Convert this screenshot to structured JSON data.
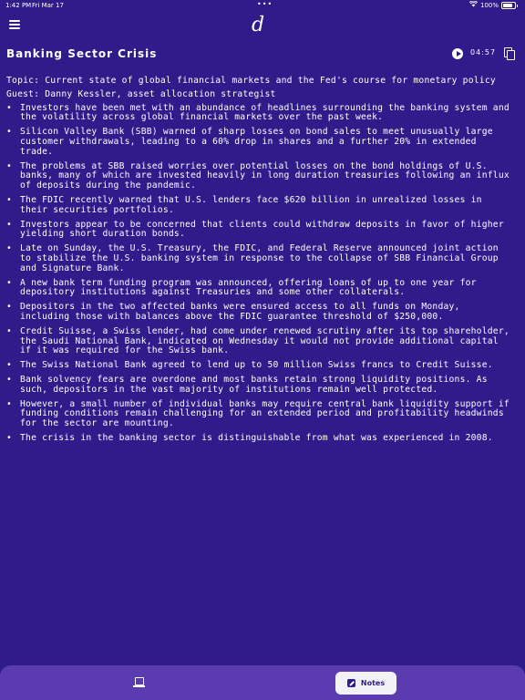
{
  "status_bar": {
    "time": "1:42 PM",
    "date": "Fri Mar 17",
    "battery": "100%"
  },
  "app": {
    "logo": "d"
  },
  "header": {
    "title": "Banking Sector Crisis",
    "duration": "04:57"
  },
  "content": {
    "topic": "Topic: Current state of global financial markets and the Fed's course for monetary policy",
    "guest": "Guest: Danny Kessler, asset allocation strategist",
    "bullets": [
      "Investors have been met with an abundance of headlines surrounding the banking system and the volatility across global financial markets over the past week.",
      "Silicon Valley Bank (SBB) warned of sharp losses on bond sales to meet unusually large customer withdrawals, leading to a 60% drop in shares and a further 20% in extended trade.",
      "The problems at SBB raised worries over potential losses on the bond holdings of U.S. banks, many of which are invested heavily in long duration treasuries following an influx of deposits during the pandemic.",
      "The FDIC recently warned that U.S. lenders face $620 billion in unrealized losses in their securities portfolios.",
      "Investors appear to be concerned that clients could withdraw deposits in favor of higher yielding short duration bonds.",
      "Late on Sunday, the U.S. Treasury, the FDIC, and Federal Reserve announced joint action to stabilize the U.S. banking system in response to the collapse of SBB Financial Group and Signature Bank.",
      "A new bank term funding program was announced, offering loans of up to one year for depository institutions against Treasuries and some other collaterals.",
      "Depositors in the two affected banks were ensured access to all funds on Monday, including those with balances above the FDIC guarantee threshold of $250,000.",
      "Credit Suisse, a Swiss lender, had come under renewed scrutiny after its top shareholder, the Saudi National Bank, indicated on Wednesday it would not provide additional capital if it was required for the Swiss bank.",
      "The Swiss National Bank agreed to lend up to 50 million Swiss francs to Credit Suisse.",
      "Bank solvency fears are overdone and most banks retain strong liquidity positions. As such, depositors in the vast majority of institutions remain well protected.",
      "However, a small number of individual banks may require central bank liquidity support if funding conditions remain challenging for an extended period and profitability headwinds for the sector are mounting.",
      "The crisis in the banking sector is distinguishable from what was experienced in 2008."
    ]
  },
  "bottom_bar": {
    "notes_label": "Notes"
  }
}
